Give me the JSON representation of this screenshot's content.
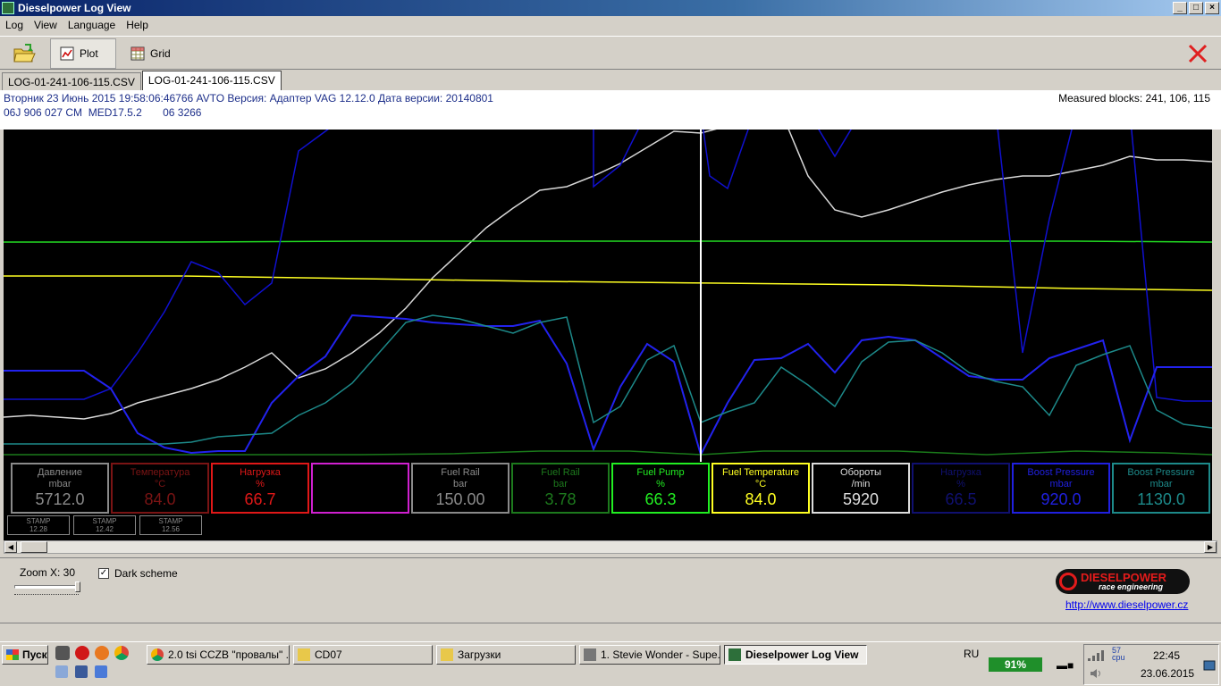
{
  "window": {
    "title": "Dieselpower Log View",
    "controls": [
      "_",
      "□",
      "×"
    ]
  },
  "menu": [
    "Log",
    "View",
    "Language",
    "Help"
  ],
  "toolbar": {
    "open_icon": "folder-open-icon",
    "plot_label": "Plot",
    "grid_label": "Grid",
    "close_icon": "close-x-icon",
    "close_color": "#e02020"
  },
  "tabs": [
    {
      "label": "LOG-01-241-106-115.CSV",
      "active": false
    },
    {
      "label": "LOG-01-241-106-115.CSV",
      "active": true
    }
  ],
  "info": {
    "line1": "Вторник 23 Июнь 2015 19:58:06:46766 AVTO Версия: Адаптер VAG 12.12.0 Дата версии: 20140801",
    "line2": "06J 906 027 CM  MED17.5.2       06 3266",
    "measured_blocks": "Measured blocks: 241, 106, 115"
  },
  "plot": {
    "background": "#000000",
    "cursor_color": "#ffffff"
  },
  "chart_data": {
    "type": "line",
    "grid": false,
    "series": [
      {
        "name": "Давление",
        "color": "#d8d8d8"
      },
      {
        "name": "Fuel Pump",
        "color": "#22dd22"
      },
      {
        "name": "Fuel Temperature",
        "color": "#ffff22"
      },
      {
        "name": "Нагрузка",
        "color": "#1010d0"
      },
      {
        "name": "Boost Pressure",
        "color": "#2222ee"
      },
      {
        "name": "Boost Pressure",
        "color": "#1d8a8a"
      },
      {
        "name": "Fuel Rail",
        "color": "#1a7a1a"
      },
      {
        "name": "Нагрузка",
        "color": "#101080"
      }
    ]
  },
  "gauges": [
    {
      "name": "Давление",
      "unit": "mbar",
      "value": "5712.0",
      "color": "#8a8a8a",
      "border": "#8a8a8a"
    },
    {
      "name": "Температура",
      "unit": "°C",
      "value": "84.0",
      "color": "#7a1414",
      "border": "#7a1414"
    },
    {
      "name": "Нагрузка",
      "unit": "%",
      "value": "66.7",
      "color": "#e01818",
      "border": "#e01818"
    },
    {
      "name": "",
      "unit": "",
      "value": "",
      "color": "#d020d0",
      "border": "#d020d0"
    },
    {
      "name": "Fuel Rail",
      "unit": "bar",
      "value": "150.00",
      "color": "#8a8a8a",
      "border": "#8a8a8a"
    },
    {
      "name": "Fuel Rail",
      "unit": "bar",
      "value": "3.78",
      "color": "#1d7a1d",
      "border": "#1d7a1d"
    },
    {
      "name": "Fuel Pump",
      "unit": "%",
      "value": "66.3",
      "color": "#22ee22",
      "border": "#22ee22"
    },
    {
      "name": "Fuel Temperature",
      "unit": "°C",
      "value": "84.0",
      "color": "#ffff22",
      "border": "#ffff22"
    },
    {
      "name": "Обороты",
      "unit": "/min",
      "value": "5920",
      "color": "#dddddd",
      "border": "#dddddd"
    },
    {
      "name": "Нагрузка",
      "unit": "%",
      "value": "66.5",
      "color": "#101070",
      "border": "#101070"
    },
    {
      "name": "Boost Pressure",
      "unit": "mbar",
      "value": "920.0",
      "color": "#2020e0",
      "border": "#2020e0"
    },
    {
      "name": "Boost Pressure",
      "unit": "mbar",
      "value": "1130.0",
      "color": "#1d8a8a",
      "border": "#1d8a8a"
    }
  ],
  "stamps": [
    {
      "label": "STAMP",
      "value": "12.28"
    },
    {
      "label": "STAMP",
      "value": "12.42"
    },
    {
      "label": "STAMP",
      "value": "12.56"
    }
  ],
  "bottom": {
    "zoom_label": "Zoom X: 30",
    "dark_scheme_label": "Dark scheme",
    "dark_scheme_checked": "✓",
    "logo_text": "DIESELPOWER",
    "logo_sub": "race engineering",
    "link": "http://www.dieselpower.cz"
  },
  "taskbar": {
    "start_label": "Пуск",
    "tasks": [
      {
        "label": "2.0 tsi CCZB \"провалы\" ...",
        "icon": "chrome-icon",
        "active": false
      },
      {
        "label": "CD07",
        "icon": "folder-icon",
        "active": false
      },
      {
        "label": "Загрузки",
        "icon": "folder-icon",
        "active": false
      },
      {
        "label": "1. Stevie Wonder - Supe...",
        "icon": "player-icon",
        "active": false
      },
      {
        "label": "Dieselpower Log View",
        "icon": "app-icon",
        "active": true
      }
    ],
    "language": "RU",
    "battery": "91%",
    "cpu_label": "57",
    "cpu_unit": "cpu",
    "time": "22:45",
    "date": "23.06.2015"
  }
}
